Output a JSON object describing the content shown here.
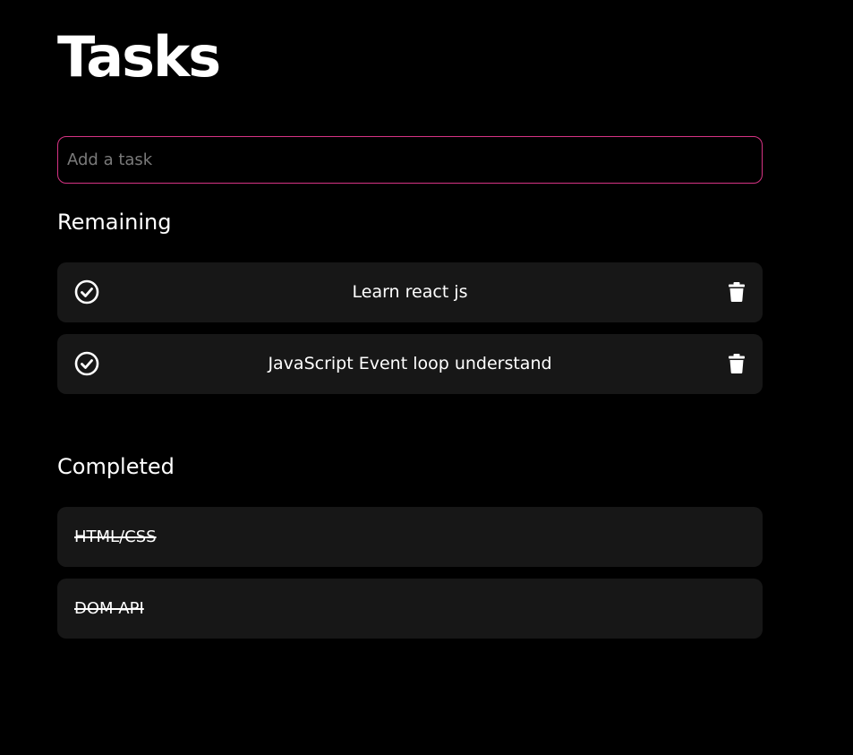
{
  "header": {
    "title": "Tasks"
  },
  "input": {
    "placeholder": "Add a task",
    "value": ""
  },
  "accent_color": "#d63384",
  "remaining": {
    "heading": "Remaining",
    "items": [
      {
        "label": "Learn react js",
        "check_icon": "check-circle-icon",
        "delete_icon": "trash-icon"
      },
      {
        "label": "JavaScript Event loop understand",
        "check_icon": "check-circle-icon",
        "delete_icon": "trash-icon"
      }
    ]
  },
  "completed": {
    "heading": "Completed",
    "items": [
      {
        "label": "HTML/CSS"
      },
      {
        "label": "DOM API"
      }
    ]
  }
}
